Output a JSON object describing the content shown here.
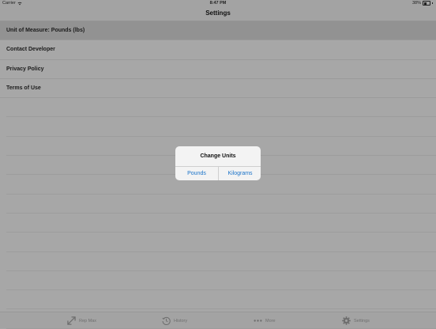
{
  "status_bar": {
    "carrier": "Carrier",
    "time": "8:47 PM",
    "battery": "38%"
  },
  "nav": {
    "title": "Settings"
  },
  "settings": {
    "items": [
      {
        "label": "Unit of Measure: Pounds (lbs)"
      },
      {
        "label": "Contact Developer"
      },
      {
        "label": "Privacy Policy"
      },
      {
        "label": "Terms of Use"
      }
    ]
  },
  "alert": {
    "title": "Change Units",
    "buttons": [
      "Pounds",
      "Kilograms"
    ]
  },
  "tabbar": {
    "tabs": [
      {
        "label": "Rep Max",
        "icon": "expand-arrows-icon"
      },
      {
        "label": "History",
        "icon": "history-clock-icon"
      },
      {
        "label": "More",
        "icon": "more-dots-icon"
      },
      {
        "label": "Settings",
        "icon": "gear-icon"
      }
    ]
  },
  "colors": {
    "accent": "#1a73c9",
    "dim_background": "#a7a7a7",
    "selected_row": "#929292"
  }
}
